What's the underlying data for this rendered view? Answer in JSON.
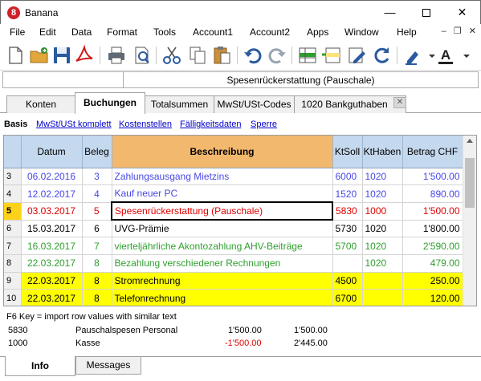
{
  "window": {
    "title": "Banana",
    "app_icon_glyph": "8",
    "min_glyph": "—",
    "close_glyph": "✕"
  },
  "menu": [
    "File",
    "Edit",
    "Data",
    "Format",
    "Tools",
    "Account1",
    "Account2",
    "Apps",
    "Window",
    "Help"
  ],
  "mdi": {
    "minimize": "–",
    "restore": "❐",
    "close": "✕"
  },
  "toolbar_icons": [
    "new-file-icon",
    "open-folder-icon",
    "save-icon",
    "pdf-icon",
    "print-icon",
    "print-preview-icon",
    "cut-icon",
    "copy-icon",
    "paste-icon",
    "undo-icon",
    "redo-icon",
    "add-row-icon",
    "insert-row-icon",
    "edit-pencil-icon",
    "recalculate-icon",
    "highlighter-icon",
    "font-color-icon"
  ],
  "font_color_glyph": "A",
  "cellbar": {
    "text": "Spesenrückerstattung (Pauschale)"
  },
  "tabs": [
    {
      "label": "Konten",
      "active": false
    },
    {
      "label": "Buchungen",
      "active": true
    },
    {
      "label": "Totalsummen",
      "active": false
    },
    {
      "label": "MwSt/USt-Codes",
      "active": false
    },
    {
      "label": "1020 Bankguthaben",
      "active": false
    }
  ],
  "tab_close_glyph": "✕",
  "views": [
    "Basis",
    "MwSt/USt komplett",
    "Kostenstellen",
    "Fälligkeitsdaten",
    "Sperre"
  ],
  "table": {
    "headers": [
      "",
      "Datum",
      "Beleg",
      "Beschreibung",
      "KtSoll",
      "KtHaben",
      "Betrag CHF"
    ],
    "rows": [
      {
        "n": "3",
        "date": "06.02.2016",
        "doc": "3",
        "desc": "Zahlungsausgang Mietzins",
        "debit": "6000",
        "credit": "1020",
        "amount": "1'500.00",
        "style": "blue"
      },
      {
        "n": "4",
        "date": "12.02.2017",
        "doc": "4",
        "desc": "Kauf neuer PC",
        "debit": "1520",
        "credit": "1020",
        "amount": "890.00",
        "style": "blue"
      },
      {
        "n": "5",
        "date": "03.03.2017",
        "doc": "5",
        "desc": "Spesenrückerstattung (Pauschale)",
        "debit": "5830",
        "credit": "1000",
        "amount": "1'500.00",
        "style": "red"
      },
      {
        "n": "6",
        "date": "15.03.2017",
        "doc": "6",
        "desc": "UVG-Prämie",
        "debit": "5730",
        "credit": "1020",
        "amount": "1'800.00",
        "style": "black"
      },
      {
        "n": "7",
        "date": "16.03.2017",
        "doc": "7",
        "desc": "vierteljährliche Akontozahlung AHV-Beiträge",
        "debit": "5700",
        "credit": "1020",
        "amount": "2'590.00",
        "style": "green"
      },
      {
        "n": "8",
        "date": "22.03.2017",
        "doc": "8",
        "desc": "Bezahlung verschiedener Rechnungen",
        "debit": "",
        "credit": "1020",
        "amount": "479.00",
        "style": "green"
      },
      {
        "n": "9",
        "date": "22.03.2017",
        "doc": "8",
        "desc": "Stromrechnung",
        "debit": "4500",
        "credit": "",
        "amount": "250.00",
        "style": "yellow"
      },
      {
        "n": "10",
        "date": "22.03.2017",
        "doc": "8",
        "desc": "Telefonrechnung",
        "debit": "6700",
        "credit": "",
        "amount": "120.00",
        "style": "yellow"
      }
    ]
  },
  "info": {
    "hint": "F6 Key = import row values with similar text",
    "rows": [
      {
        "account": "5830",
        "name": "Pauschalspesen Personal",
        "amount": "1'500.00",
        "balance": "1'500.00",
        "negative": false
      },
      {
        "account": "1000",
        "name": "Kasse",
        "amount": "-1'500.00",
        "balance": "2'445.00",
        "negative": true
      }
    ]
  },
  "bottom_tabs": [
    {
      "label": "Info",
      "active": true
    },
    {
      "label": "Messages",
      "active": false
    }
  ],
  "colors": {
    "red": "#e00000",
    "blue": "#4848e8",
    "green": "#2e9e2e",
    "highlight": "#ffff00",
    "header_desc": "#f2b86d",
    "header": "#c4d8ee"
  }
}
